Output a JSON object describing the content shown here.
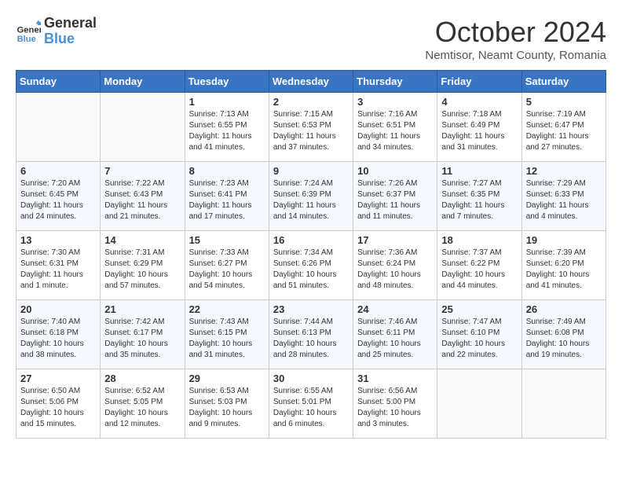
{
  "logo": {
    "general": "General",
    "blue": "Blue"
  },
  "title": "October 2024",
  "location": "Nemtisor, Neamt County, Romania",
  "days_of_week": [
    "Sunday",
    "Monday",
    "Tuesday",
    "Wednesday",
    "Thursday",
    "Friday",
    "Saturday"
  ],
  "weeks": [
    [
      {
        "day": "",
        "info": ""
      },
      {
        "day": "",
        "info": ""
      },
      {
        "day": "1",
        "info": "Sunrise: 7:13 AM\nSunset: 6:55 PM\nDaylight: 11 hours and 41 minutes."
      },
      {
        "day": "2",
        "info": "Sunrise: 7:15 AM\nSunset: 6:53 PM\nDaylight: 11 hours and 37 minutes."
      },
      {
        "day": "3",
        "info": "Sunrise: 7:16 AM\nSunset: 6:51 PM\nDaylight: 11 hours and 34 minutes."
      },
      {
        "day": "4",
        "info": "Sunrise: 7:18 AM\nSunset: 6:49 PM\nDaylight: 11 hours and 31 minutes."
      },
      {
        "day": "5",
        "info": "Sunrise: 7:19 AM\nSunset: 6:47 PM\nDaylight: 11 hours and 27 minutes."
      }
    ],
    [
      {
        "day": "6",
        "info": "Sunrise: 7:20 AM\nSunset: 6:45 PM\nDaylight: 11 hours and 24 minutes."
      },
      {
        "day": "7",
        "info": "Sunrise: 7:22 AM\nSunset: 6:43 PM\nDaylight: 11 hours and 21 minutes."
      },
      {
        "day": "8",
        "info": "Sunrise: 7:23 AM\nSunset: 6:41 PM\nDaylight: 11 hours and 17 minutes."
      },
      {
        "day": "9",
        "info": "Sunrise: 7:24 AM\nSunset: 6:39 PM\nDaylight: 11 hours and 14 minutes."
      },
      {
        "day": "10",
        "info": "Sunrise: 7:26 AM\nSunset: 6:37 PM\nDaylight: 11 hours and 11 minutes."
      },
      {
        "day": "11",
        "info": "Sunrise: 7:27 AM\nSunset: 6:35 PM\nDaylight: 11 hours and 7 minutes."
      },
      {
        "day": "12",
        "info": "Sunrise: 7:29 AM\nSunset: 6:33 PM\nDaylight: 11 hours and 4 minutes."
      }
    ],
    [
      {
        "day": "13",
        "info": "Sunrise: 7:30 AM\nSunset: 6:31 PM\nDaylight: 11 hours and 1 minute."
      },
      {
        "day": "14",
        "info": "Sunrise: 7:31 AM\nSunset: 6:29 PM\nDaylight: 10 hours and 57 minutes."
      },
      {
        "day": "15",
        "info": "Sunrise: 7:33 AM\nSunset: 6:27 PM\nDaylight: 10 hours and 54 minutes."
      },
      {
        "day": "16",
        "info": "Sunrise: 7:34 AM\nSunset: 6:26 PM\nDaylight: 10 hours and 51 minutes."
      },
      {
        "day": "17",
        "info": "Sunrise: 7:36 AM\nSunset: 6:24 PM\nDaylight: 10 hours and 48 minutes."
      },
      {
        "day": "18",
        "info": "Sunrise: 7:37 AM\nSunset: 6:22 PM\nDaylight: 10 hours and 44 minutes."
      },
      {
        "day": "19",
        "info": "Sunrise: 7:39 AM\nSunset: 6:20 PM\nDaylight: 10 hours and 41 minutes."
      }
    ],
    [
      {
        "day": "20",
        "info": "Sunrise: 7:40 AM\nSunset: 6:18 PM\nDaylight: 10 hours and 38 minutes."
      },
      {
        "day": "21",
        "info": "Sunrise: 7:42 AM\nSunset: 6:17 PM\nDaylight: 10 hours and 35 minutes."
      },
      {
        "day": "22",
        "info": "Sunrise: 7:43 AM\nSunset: 6:15 PM\nDaylight: 10 hours and 31 minutes."
      },
      {
        "day": "23",
        "info": "Sunrise: 7:44 AM\nSunset: 6:13 PM\nDaylight: 10 hours and 28 minutes."
      },
      {
        "day": "24",
        "info": "Sunrise: 7:46 AM\nSunset: 6:11 PM\nDaylight: 10 hours and 25 minutes."
      },
      {
        "day": "25",
        "info": "Sunrise: 7:47 AM\nSunset: 6:10 PM\nDaylight: 10 hours and 22 minutes."
      },
      {
        "day": "26",
        "info": "Sunrise: 7:49 AM\nSunset: 6:08 PM\nDaylight: 10 hours and 19 minutes."
      }
    ],
    [
      {
        "day": "27",
        "info": "Sunrise: 6:50 AM\nSunset: 5:06 PM\nDaylight: 10 hours and 15 minutes."
      },
      {
        "day": "28",
        "info": "Sunrise: 6:52 AM\nSunset: 5:05 PM\nDaylight: 10 hours and 12 minutes."
      },
      {
        "day": "29",
        "info": "Sunrise: 6:53 AM\nSunset: 5:03 PM\nDaylight: 10 hours and 9 minutes."
      },
      {
        "day": "30",
        "info": "Sunrise: 6:55 AM\nSunset: 5:01 PM\nDaylight: 10 hours and 6 minutes."
      },
      {
        "day": "31",
        "info": "Sunrise: 6:56 AM\nSunset: 5:00 PM\nDaylight: 10 hours and 3 minutes."
      },
      {
        "day": "",
        "info": ""
      },
      {
        "day": "",
        "info": ""
      }
    ]
  ]
}
